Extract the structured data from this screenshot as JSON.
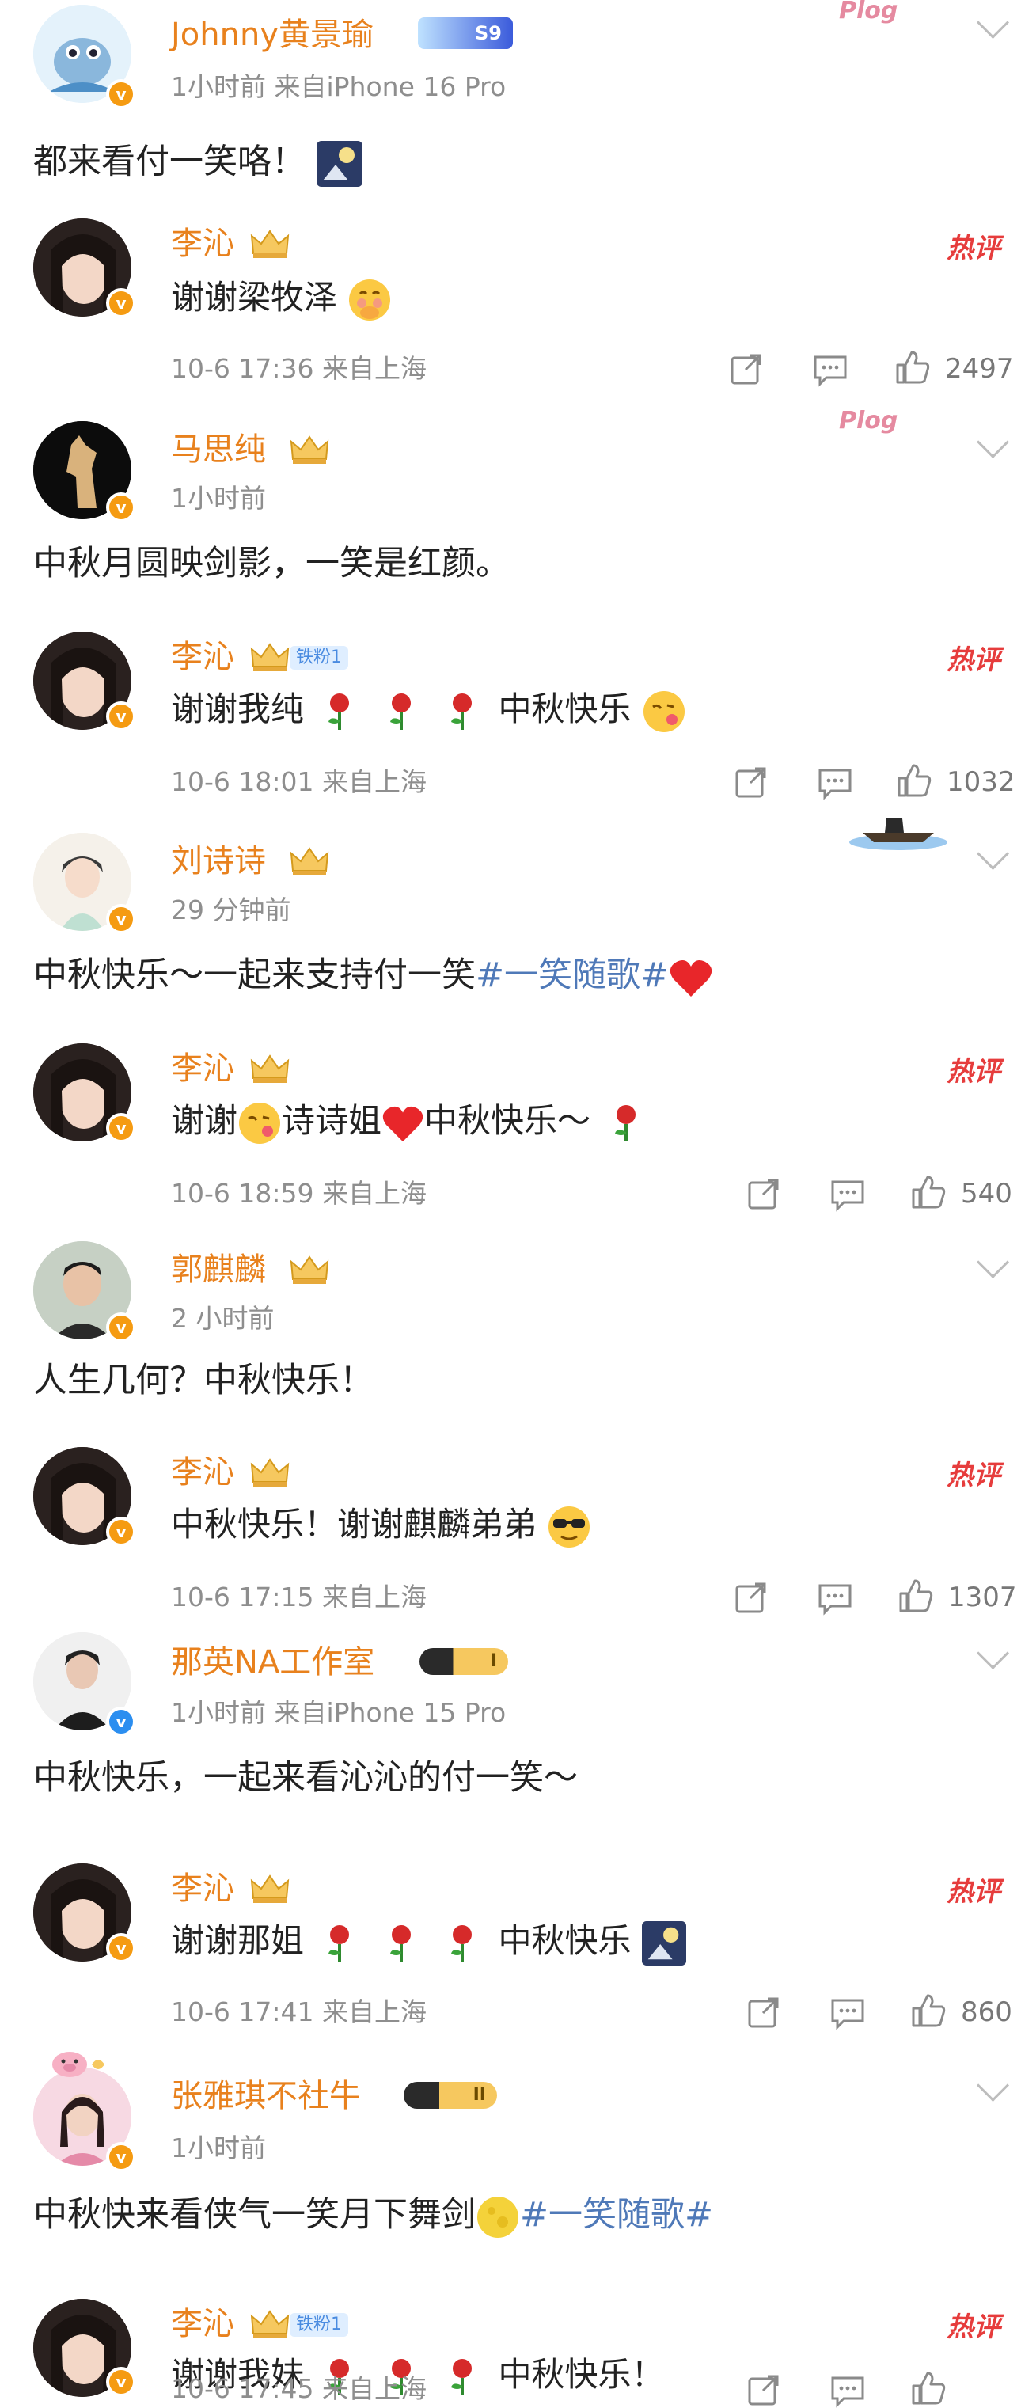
{
  "threads": [
    {
      "author": "Johnny黄景瑜",
      "author_badge_text": "S9",
      "meta": "1小时前  来自iPhone 16 Pro",
      "text": "都来看付一笑咯！",
      "reply": {
        "author": "李沁",
        "text": "谢谢梁牧泽",
        "meta": "10-6 17:36 来自上海",
        "likes": "2497"
      }
    },
    {
      "author": "马思纯",
      "meta": "1小时前",
      "text": "中秋月圆映剑影，一笑是红颜。",
      "reply": {
        "author": "李沁",
        "fan_badge": "铁粉1",
        "text_a": "谢谢我纯",
        "text_b": "中秋快乐",
        "meta": "10-6 18:01 来自上海",
        "likes": "1032"
      }
    },
    {
      "author": "刘诗诗",
      "meta": "29 分钟前",
      "text": "中秋快乐～一起来支持付一笑",
      "hashtag": "#一笑随歌#",
      "reply": {
        "author": "李沁",
        "text_a": "谢谢",
        "text_b": "诗诗姐",
        "text_c": "中秋快乐～",
        "meta": "10-6 18:59 来自上海",
        "likes": "540"
      }
    },
    {
      "author": "郭麒麟",
      "meta": "2 小时前",
      "text": "人生几何？中秋快乐！",
      "reply": {
        "author": "李沁",
        "text": "中秋快乐！谢谢麒麟弟弟",
        "meta": "10-6 17:15 来自上海",
        "likes": "1307"
      }
    },
    {
      "author": "那英NA工作室",
      "level_badge": "I",
      "meta": "1小时前  来自iPhone 15 Pro",
      "text": "中秋快乐，一起来看沁沁的付一笑～",
      "reply": {
        "author": "李沁",
        "text_a": "谢谢那姐",
        "text_b": "中秋快乐",
        "meta": "10-6 17:41 来自上海",
        "likes": "860"
      }
    },
    {
      "author": "张雅琪不社牛",
      "level_badge": "II",
      "meta": "1小时前",
      "text": "中秋快来看侠气一笑月下舞剑",
      "hashtag": "#一笑随歌#",
      "reply": {
        "author": "李沁",
        "fan_badge": "铁粉1",
        "text_a": "谢谢我妹",
        "text_b": "中秋快乐！",
        "meta": "10-6 17:45 来自上海"
      }
    }
  ],
  "hot_label": "热评",
  "v_mark": "v",
  "stickers": {
    "plog": "Plog"
  },
  "colors": {
    "name": "#e8811d",
    "hashtag": "#4f79b8",
    "hot": "#e63c3c",
    "meta": "#8e8e8e"
  }
}
